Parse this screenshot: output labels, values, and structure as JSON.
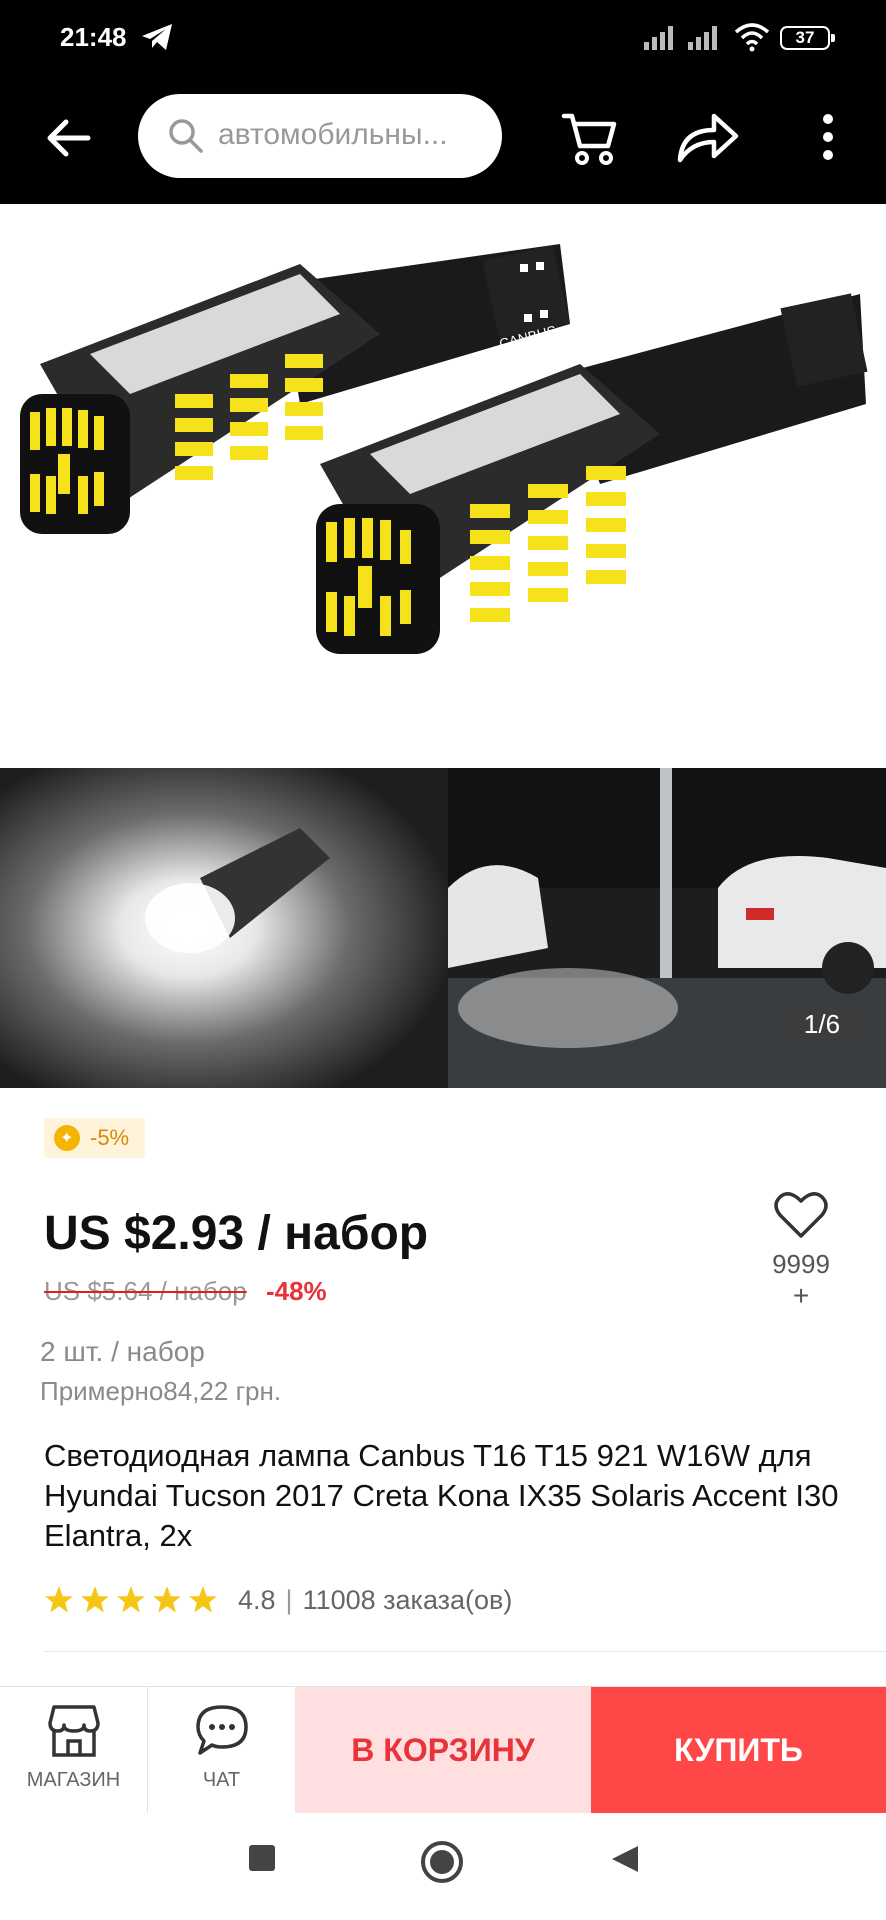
{
  "status_bar": {
    "time": "21:48",
    "battery": "37"
  },
  "toolbar": {
    "search_placeholder": "автомобильны..."
  },
  "gallery": {
    "counter": "1/6"
  },
  "product": {
    "discount_badge": "-5%",
    "price": "US $2.93 / набор",
    "old_price": "US $5.64 / набор",
    "discount_percent": "-48%",
    "favorites_count": "9999",
    "favorites_plus": "+",
    "unit": "2 шт. / набор",
    "approx_price": "Примерно84,22 грн.",
    "title": "Светодиодная лампа Canbus T16 T15 921 W16W для Hyundai Tucson 2017 Creta Kona IX35 Solaris Accent I30 Elantra, 2x",
    "rating_value": "4.8",
    "rating_stars": 5,
    "orders": "11008 заказа(ов)"
  },
  "action_bar": {
    "store_label": "МАГАЗИН",
    "chat_label": "ЧАТ",
    "cart_label": "В КОРЗИНУ",
    "buy_label": "КУПИТЬ"
  },
  "colors": {
    "accent_red": "#ff4747",
    "cart_bg": "#ffdfdf",
    "star": "#f5c518",
    "badge_bg": "#fff3dc"
  },
  "icons": [
    "back-arrow-icon",
    "search-icon",
    "cart-icon",
    "share-icon",
    "more-vertical-icon",
    "heart-icon",
    "store-icon",
    "chat-icon",
    "star-icon",
    "nav-recents-icon",
    "nav-home-icon",
    "nav-back-icon"
  ]
}
